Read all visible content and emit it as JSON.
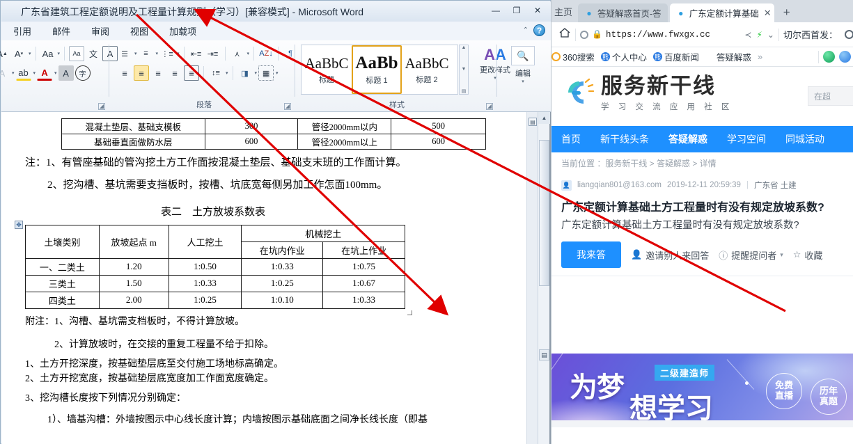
{
  "word": {
    "title": "广东省建筑工程定额说明及工程量计算规则（学习）[兼容模式] - Microsoft Word",
    "window_buttons": {
      "minimize": "—",
      "restore": "❐",
      "close": "✕"
    },
    "ribbon_tabs": [
      "引用",
      "邮件",
      "审阅",
      "视图",
      "加载项"
    ],
    "help_icon": "?",
    "collapse_icon": "⌃",
    "groups": {
      "font": {
        "label": "",
        "icons": [
          "grow-font-icon",
          "shrink-font-icon",
          "change-case-icon",
          "clear-formatting-icon",
          "phonetic-guide-icon",
          "character-border-icon",
          "text-effects-icon",
          "highlight-icon",
          "font-color-icon",
          "character-shading-icon",
          "enclose-characters-icon"
        ]
      },
      "paragraph": {
        "label": "段落",
        "icons": [
          "bullets-icon",
          "numbering-icon",
          "multilevel-list-icon",
          "decrease-indent-icon",
          "increase-indent-icon",
          "asian-layout-icon",
          "sort-icon",
          "show-marks-icon",
          "align-left-icon",
          "align-center-icon",
          "align-right-icon",
          "justify-icon",
          "distribute-icon",
          "line-spacing-icon",
          "shading-icon",
          "borders-icon"
        ]
      },
      "styles": {
        "label": "样式",
        "tiles": [
          {
            "sample": "AaBbC",
            "name": "标题"
          },
          {
            "sample": "AaBb",
            "name": "标题 1"
          },
          {
            "sample": "AaBbC",
            "name": "标题 2"
          }
        ],
        "change_styles": "更改样式"
      },
      "editing": {
        "label": "",
        "title": "编辑"
      }
    },
    "document": {
      "table1": {
        "rows": [
          [
            "混凝土垫层、基础支模板",
            "300",
            "管径2000mm以内",
            "500"
          ],
          [
            "基础垂直面做防水层",
            "600",
            "管径2000mm以上",
            "600"
          ]
        ]
      },
      "notes": [
        "注：1、有管座基础的管沟挖土方工作面按混凝土垫层、基础支末班的工作面计算。",
        "2、挖沟槽、基坑需要支挡板时，按槽、坑底宽每侧另加工作怎面100mm。"
      ],
      "table2_caption": "表二　土方放坡系数表",
      "table2": {
        "headers_row1": [
          "土壤类别",
          "放坡起点 m",
          "人工挖土",
          "机械挖土"
        ],
        "headers_row2": [
          "在坑内作业",
          "在坑上作业"
        ],
        "rows": [
          [
            "一、二类土",
            "1.20",
            "1:0.50",
            "1:0.33",
            "1:0.75"
          ],
          [
            "三类土",
            "1.50",
            "1:0.33",
            "1:0.25",
            "1:0.67"
          ],
          [
            "四类土",
            "2.00",
            "1:0.25",
            "1:0.10",
            "1:0.33"
          ]
        ]
      },
      "footnotes": [
        "附注：1、沟槽、基坑需支档板时，不得计算放坡。",
        "2、计算放坡时，在交接的重复工程量不给于扣除。",
        "1、土方开挖深度，按基础垫层底至交付施工场地标高确定。",
        "2、土方开挖宽度，按基础垫层底宽度加工作面宽度确定。",
        "3、挖沟槽长度按下列情况分别确定：",
        "1）、墙基沟槽：外墙按图示中心线长度计算；内墙按图示基础底面之间净长线长度（即基"
      ]
    }
  },
  "browser": {
    "home_label": "主页",
    "tabs": [
      {
        "title": "答疑解惑首页-答",
        "active": false,
        "favicon": "site-favicon"
      },
      {
        "title": "广东定额计算基础",
        "active": true,
        "favicon": "site-favicon",
        "close": "✕"
      }
    ],
    "new_tab": "+",
    "url": "https://www.fwxgx.cc",
    "url_icons": {
      "shield": "●",
      "lock": "🔒",
      "share": "<",
      "bolt": "⚡",
      "chevron": "⌄"
    },
    "side_label": "切尔西首发：",
    "bookmarks": [
      {
        "label": "360搜索",
        "favicon": "360-icon"
      },
      {
        "label": "个人中心",
        "favicon": "baidu-icon"
      },
      {
        "label": "百度新闻",
        "favicon": "baidu-icon"
      },
      {
        "label": "答疑解惑",
        "favicon": "site-favicon"
      }
    ],
    "bookmarks_more": "»"
  },
  "site": {
    "brand": {
      "name": "服务新干线",
      "slogan": "学 习 交 流 应 用 社 区"
    },
    "search_placeholder": "在超",
    "nav": [
      {
        "label": "首页",
        "active": false
      },
      {
        "label": "新干线头条",
        "active": false
      },
      {
        "label": "答疑解惑",
        "active": true
      },
      {
        "label": "学习空间",
        "active": false
      },
      {
        "label": "同城活动",
        "active": false
      }
    ],
    "breadcrumb": "当前位置 ：服务新干线 > 答疑解惑 > 详情",
    "question": {
      "author": "liangqian801@163.com",
      "datetime": "2019-12-11 20:59:39",
      "separator": "|",
      "tags": "广东省 土建",
      "title": "广东定额计算基础土方工程量时有没有规定放坡系数?",
      "body": "广东定额计算基础土方工程量时有没有规定放坡系数?"
    },
    "actions": {
      "answer_button": "我来答",
      "invite": "邀请别人来回答",
      "remind": "提醒提问者",
      "favorite": "收藏"
    },
    "ad": {
      "tag": "二级建造师",
      "line1": "为梦",
      "line2": "想学习",
      "badge1_line1": "免费",
      "badge1_line2": "直播",
      "badge2_line1": "历年",
      "badge2_line2": "真题"
    }
  },
  "colors": {
    "accent_blue": "#1e90ff",
    "word_chrome": "#dce6f0",
    "annotation_red": "#e00000",
    "style_highlight": "#fde9a9"
  }
}
